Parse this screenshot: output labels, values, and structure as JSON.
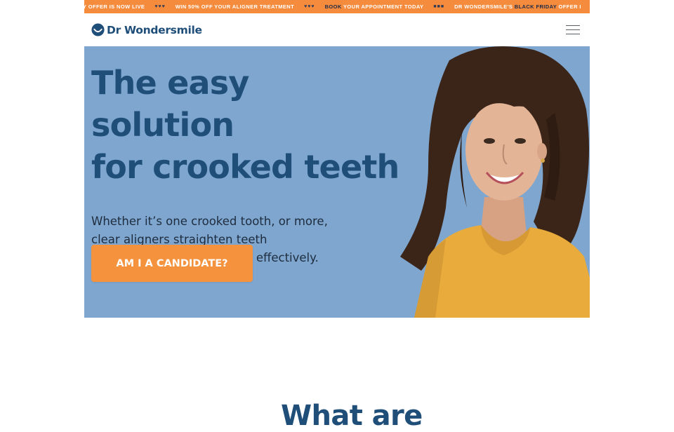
{
  "ticker": {
    "segments": [
      {
        "pre": "Y OFFER IS NOW LIVE",
        "hl": "",
        "post": ""
      },
      {
        "pre": "WIN 50% OFF YOUR ALIGNER TREATMENT",
        "hl": "",
        "post": ""
      },
      {
        "pre": "",
        "hl": "BOOK",
        "post": " YOUR APPOINTMENT TODAY"
      },
      {
        "pre": "DR WONDERSMILE'S ",
        "hl": "BLACK FRIDAY",
        "post": " OFFER I"
      }
    ],
    "separators": [
      "♥♥♥",
      "♥♥♥",
      "■■■"
    ]
  },
  "header": {
    "brand": "Dr Wondersmile",
    "logo_icon": "smile-logo-icon",
    "menu_icon": "hamburger-menu-icon"
  },
  "hero": {
    "title_line1": "The easy solution",
    "title_line2": "for crooked teeth",
    "subtitle": "Whether it’s one crooked tooth, or more, clear aligners straighten teeth comfortably, affordably and effectively.",
    "cta_label": "AM I A CANDIDATE?",
    "image_alt": "smiling-woman-photo"
  },
  "section": {
    "heading_partial": "What are"
  },
  "colors": {
    "ticker_bg": "#f58b3c",
    "brand_blue": "#1f4e79",
    "hero_bg": "#7ea6cf",
    "cta_bg": "#f5923e",
    "shirt": "#e9ac3c"
  }
}
